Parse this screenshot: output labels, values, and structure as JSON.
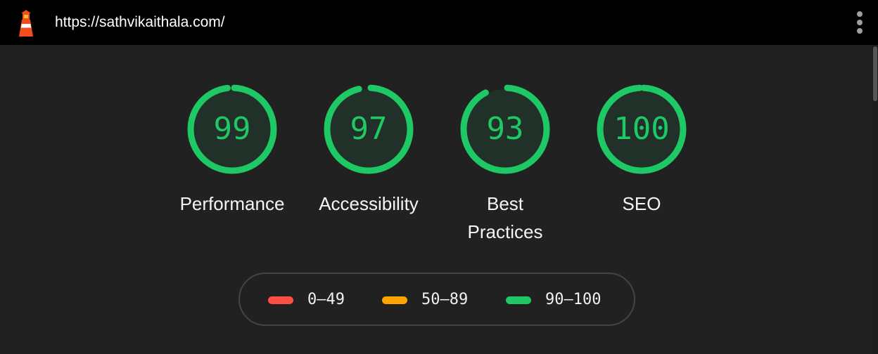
{
  "header": {
    "url": "https://sathvikaithala.com/",
    "logo_icon": "lighthouse-icon",
    "menu_icon": "more-vert-icon"
  },
  "scores": [
    {
      "label": "Performance",
      "score": "99",
      "value": 99
    },
    {
      "label": "Accessibility",
      "score": "97",
      "value": 97
    },
    {
      "label": "Best Practices",
      "score": "93",
      "value": 93
    },
    {
      "label": "SEO",
      "score": "100",
      "value": 100
    }
  ],
  "legend": [
    {
      "range": "0–49",
      "color": "#ff4e42"
    },
    {
      "range": "50–89",
      "color": "#ffa400"
    },
    {
      "range": "90–100",
      "color": "#1ec864"
    }
  ],
  "colors": {
    "pass": "#1ec864",
    "pass_fill": "#22302a",
    "background": "#212121",
    "header": "#000000"
  }
}
